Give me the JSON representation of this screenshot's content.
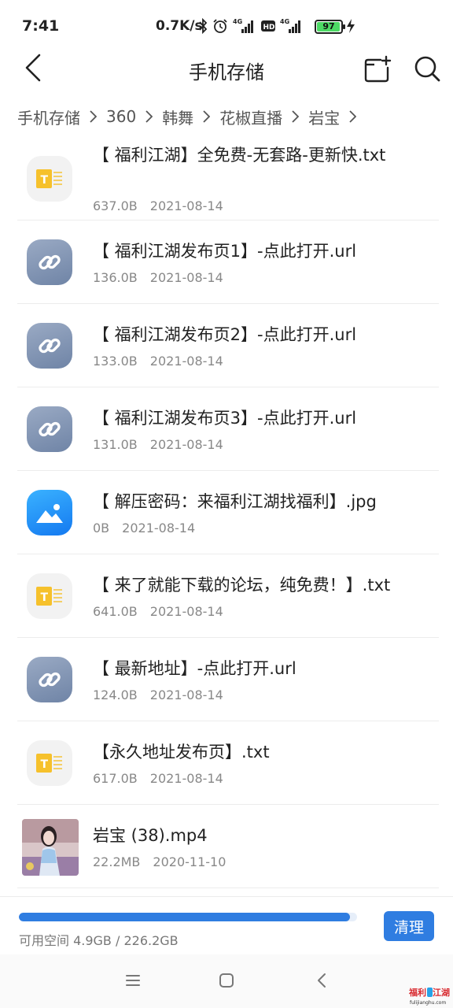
{
  "status_bar": {
    "time": "7:41",
    "net_speed": "0.7K/s",
    "icons": [
      "bluetooth-icon",
      "alarm-icon",
      "signal-4g-icon",
      "hd-icon",
      "signal-4g-icon"
    ],
    "battery_level": 97,
    "battery_text": "97",
    "charging": true
  },
  "header": {
    "title": "手机存储",
    "back_icon": "chevron-left-icon",
    "new_folder_icon": "new-folder-icon",
    "search_icon": "search-icon"
  },
  "breadcrumb": [
    "手机存储",
    "360",
    "韩舞",
    "花椒直播",
    "岩宝"
  ],
  "files": [
    {
      "name": "【 福利江湖】全免费-无套路-更新快.txt",
      "size": "637.0B",
      "date": "2021-08-14",
      "type": "txt"
    },
    {
      "name": "【 福利江湖发布页1】-点此打开.url",
      "size": "136.0B",
      "date": "2021-08-14",
      "type": "url"
    },
    {
      "name": "【 福利江湖发布页2】-点此打开.url",
      "size": "133.0B",
      "date": "2021-08-14",
      "type": "url"
    },
    {
      "name": "【 福利江湖发布页3】-点此打开.url",
      "size": "131.0B",
      "date": "2021-08-14",
      "type": "url"
    },
    {
      "name": "【 解压密码：来福利江湖找福利】.jpg",
      "size": "0B",
      "date": "2021-08-14",
      "type": "image"
    },
    {
      "name": "【 来了就能下载的论坛，纯免费！】.txt",
      "size": "641.0B",
      "date": "2021-08-14",
      "type": "txt"
    },
    {
      "name": "【 最新地址】-点此打开.url",
      "size": "124.0B",
      "date": "2021-08-14",
      "type": "url"
    },
    {
      "name": "【永久地址发布页】.txt",
      "size": "617.0B",
      "date": "2021-08-14",
      "type": "txt"
    },
    {
      "name": "岩宝 (38).mp4",
      "size": "22.2MB",
      "date": "2020-11-10",
      "type": "video"
    }
  ],
  "storage": {
    "text": "可用空间 4.9GB / 226.2GB",
    "used_fraction": 0.978,
    "clean_label": "清理",
    "accent": "#2f7de1"
  },
  "navbar": {
    "icons": [
      "menu-icon",
      "home-square-icon",
      "back-triangle-icon"
    ]
  },
  "watermark": {
    "text": "福利江湖",
    "subtext": "fulijianghu.com"
  }
}
